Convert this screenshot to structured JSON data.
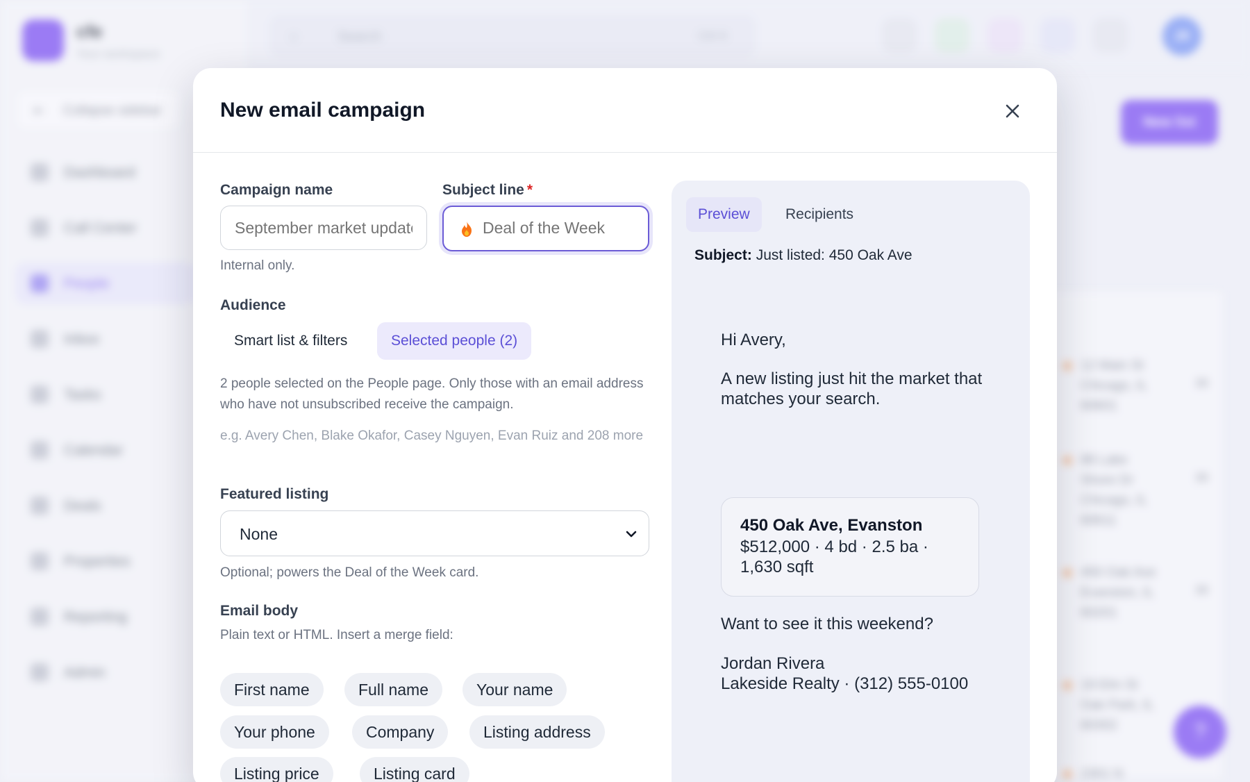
{
  "app": {
    "brand_name": "cfe",
    "workspace": "Your workspace",
    "collapse_label": "Collapse sidebar",
    "nav": [
      {
        "label": "Dashboard",
        "icon": "grid-icon"
      },
      {
        "label": "Call Center",
        "icon": "phone-icon"
      },
      {
        "label": "People",
        "icon": "people-icon",
        "active": true
      },
      {
        "label": "Inbox",
        "icon": "inbox-icon"
      },
      {
        "label": "Tasks",
        "icon": "tasks-icon"
      },
      {
        "label": "Calendar",
        "icon": "calendar-icon"
      },
      {
        "label": "Deals",
        "icon": "deals-icon"
      },
      {
        "label": "Properties",
        "icon": "home-icon"
      },
      {
        "label": "Reporting",
        "icon": "chart-icon"
      },
      {
        "label": "Admin",
        "icon": "wrench-icon"
      }
    ],
    "search_placeholder": "Search",
    "search_shortcut": "Ctrl K",
    "avatar_initials": "JR",
    "new_list_label": "New list",
    "help_label": "?"
  },
  "modal": {
    "title": "New email campaign",
    "campaign_name": {
      "label": "Campaign name",
      "placeholder": "September market update",
      "hint": "Internal only."
    },
    "subject_line": {
      "label": "Subject line",
      "required_mark": "*",
      "placeholder": "Deal of the Week"
    },
    "audience": {
      "label": "Audience",
      "options": [
        "Smart list & filters",
        "Selected people (2)"
      ],
      "selected": "Selected people (2)",
      "description": "2 people selected on the People page. Only those with an email address who have not unsubscribed receive the campaign.",
      "example": "e.g. Avery Chen, Blake Okafor, Casey Nguyen, Evan Ruiz and 208 more"
    },
    "featured_listing": {
      "label": "Featured listing",
      "value": "None",
      "hint": "Optional; powers the Deal of the Week card."
    },
    "email_body": {
      "label": "Email body",
      "hint": "Plain text or HTML. Insert a merge field:",
      "merge_fields": [
        "First name",
        "Full name",
        "Your name",
        "Your phone",
        "Company",
        "Listing address",
        "Listing price",
        "Listing card"
      ]
    },
    "preview": {
      "tabs": [
        "Preview",
        "Recipients"
      ],
      "active_tab": "Preview",
      "subject_label": "Subject:",
      "subject_value": "Just listed: 450 Oak Ave",
      "greeting": "Hi Avery,",
      "intro": "A new listing just hit the market that matches your search.",
      "listing_title": "450 Oak Ave, Evanston",
      "listing_specs": "$512,000 · 4 bd · 2.5 ba · 1,630 sqft",
      "cta": "Want to see it this weekend?",
      "signature_name": "Jordan Rivera",
      "signature_company": "Lakeside Realty · (312) 555-0100"
    }
  },
  "background_rows": [
    {
      "address": "12 Main St Chicago, IL 60601",
      "count": "30"
    },
    {
      "address": "88 Lake Shore Dr Chicago, IL 60611",
      "count": "30"
    },
    {
      "address": "450 Oak Ave Evanston, IL 60201",
      "count": "30"
    },
    {
      "address": "19 Elm St Oak Park, IL 60302",
      "count": ""
    },
    {
      "address": "2301 N",
      "count": ""
    }
  ],
  "colors": {
    "accent": "#6d3df2",
    "accent_soft": "#eceafc",
    "required": "#dc2626",
    "flame": "#f97316"
  }
}
